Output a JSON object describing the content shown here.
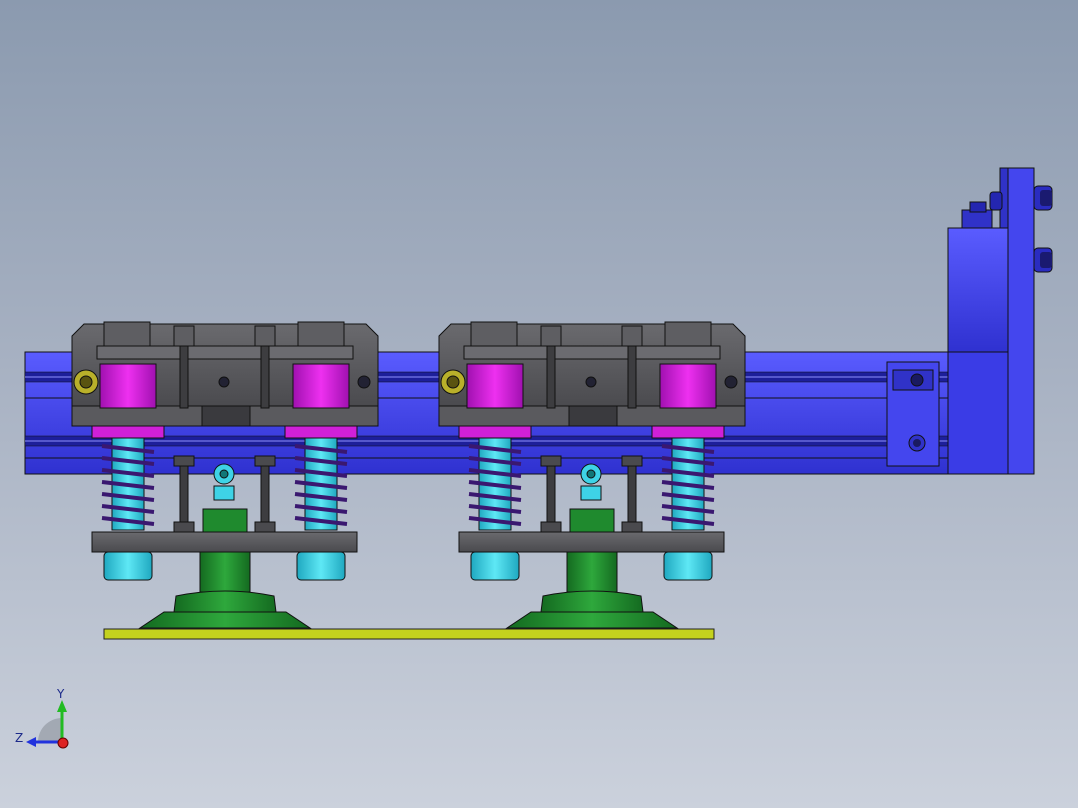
{
  "viewport": {
    "background_top": "#8b9aaf",
    "background_bottom": "#cbd1dc"
  },
  "model": {
    "rail_color": "#3b3de8",
    "block_color": "#555555",
    "bushing_color": "#d21ad8",
    "spring_color": "#4a1f7a",
    "shaft_color": "#3ed3e6",
    "cup_color": "#1f8a2e",
    "plate_color": "#b8c820"
  },
  "triad": {
    "y_label": "Y",
    "z_label": "Z",
    "y_color": "#22bb22",
    "z_color": "#2233dd",
    "x_color": "#dd2222"
  }
}
